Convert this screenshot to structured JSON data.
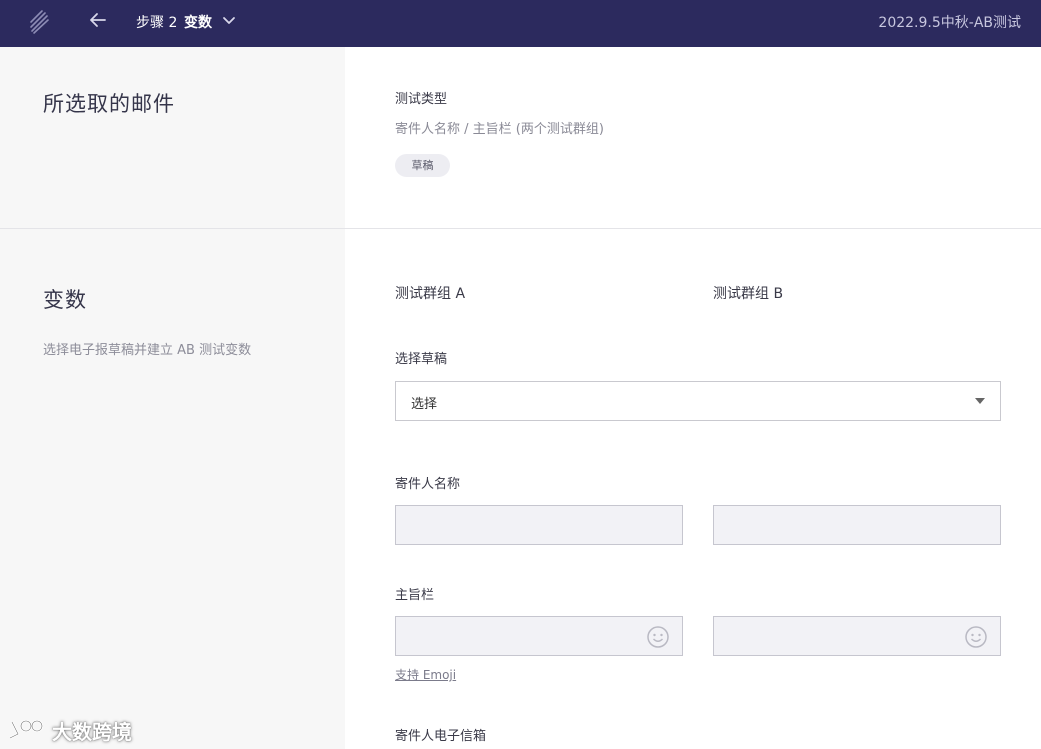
{
  "header": {
    "step_number": "步骤 2",
    "step_name": "变数",
    "campaign_name": "2022.9.5中秋-AB测试",
    "icons": {
      "logo": "brand-logo-icon",
      "back": "arrow-left-icon",
      "caret": "chevron-down-icon"
    },
    "background_color": "#2c2a5e"
  },
  "selected_email": {
    "title": "所选取的邮件",
    "test_type_label": "测试类型",
    "test_type_value": "寄件人名称 / 主旨栏 (两个测试群组)",
    "status_badge": "草稿"
  },
  "variables": {
    "title": "变数",
    "description": "选择电子报草稿并建立 AB 测试变数",
    "group_a_label": "测试群组 A",
    "group_b_label": "测试群组 B",
    "select_draft_label": "选择草稿",
    "select_draft_value": "选择",
    "sender_name_label": "寄件人名称",
    "sender_name_a": "",
    "sender_name_b": "",
    "subject_label": "主旨栏",
    "subject_a": "",
    "subject_b": "",
    "emoji_support_link": "支持 Emoji",
    "sender_email_label": "寄件人电子信箱"
  },
  "watermark": {
    "text": "大数跨境"
  }
}
